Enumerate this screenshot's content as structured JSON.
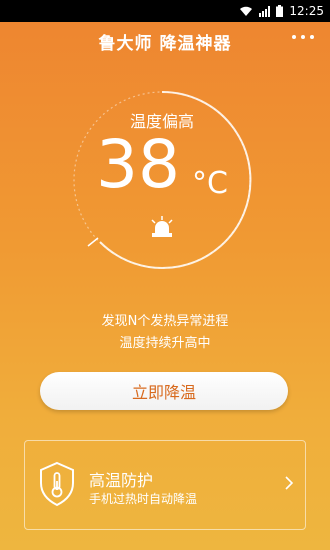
{
  "statusbar": {
    "time": "12:25"
  },
  "header": {
    "title": "鲁大师 降温神器"
  },
  "gauge": {
    "status": "温度偏高",
    "temperature": "38",
    "unit": "°C"
  },
  "messages": {
    "line1": "发现N个发热异常进程",
    "line2": "温度持续升高中"
  },
  "action": {
    "cool_label": "立即降温"
  },
  "protection": {
    "title": "高温防护",
    "subtitle": "手机过热时自动降温"
  },
  "colors": {
    "accent": "#d86a1e",
    "bg_top": "#ee8430",
    "bg_bottom": "#eeb63f"
  }
}
